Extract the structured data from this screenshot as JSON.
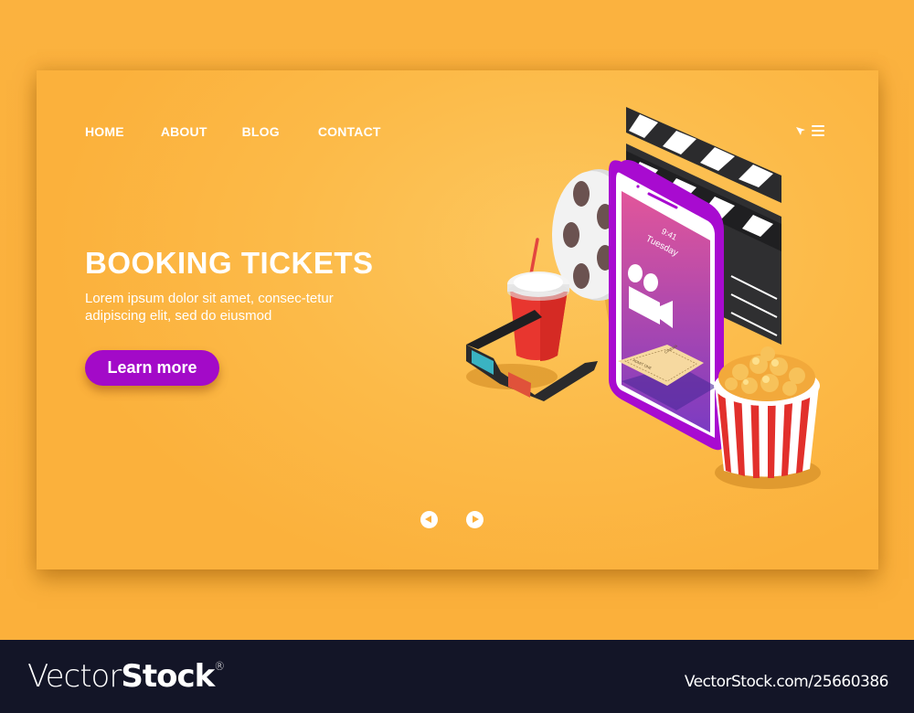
{
  "nav": {
    "items": [
      {
        "label": "HOME"
      },
      {
        "label": "ABOUT"
      },
      {
        "label": "BLOG"
      },
      {
        "label": "CONTACT"
      }
    ],
    "icons": [
      "cursor-icon",
      "hamburger-menu-icon"
    ]
  },
  "hero": {
    "title": "BOOKING TICKETS",
    "description": "Lorem ipsum dolor sit amet, consec-tetur adipiscing elit, sed do eiusmod",
    "cta_label": "Learn more"
  },
  "phone": {
    "time": "9:41",
    "day": "Tuesday",
    "ticket_text": "ADMIT ONE",
    "ticket_stub": "CINEMA"
  },
  "carousel": {
    "prev_icon": "arrow-left-icon",
    "next_icon": "arrow-right-icon"
  },
  "colors": {
    "background": "#fbb03f",
    "accent": "#a30ac8",
    "phone_frame": "#a80bd0",
    "footer": "#131527"
  },
  "footer": {
    "brand_light": "Vector",
    "brand_bold": "Stock",
    "registered": "®",
    "image_id_text": "VectorStock.com/25660386"
  }
}
